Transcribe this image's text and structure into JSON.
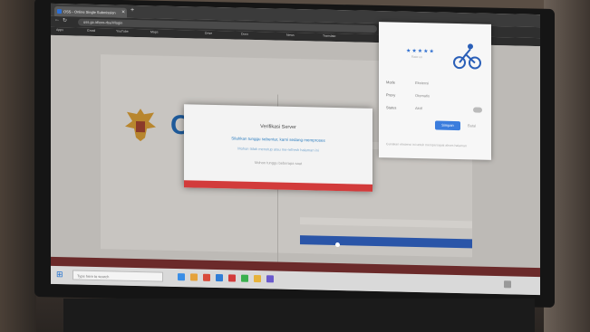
{
  "browser": {
    "tab_title": "OSS - Online Single Submission",
    "new_tab_icon": "plus-icon",
    "url": "oss.go.id/oss-rba/#/login",
    "bookmarks": [
      "Apps",
      "Gmail",
      "YouTube",
      "Maps",
      "Drive",
      "Docs",
      "News",
      "Translate"
    ]
  },
  "page": {
    "logo_text": "OSS",
    "emblem": "garuda-emblem"
  },
  "modal": {
    "title": "Verifikasi Server",
    "message": "Silahkan tunggu sebentar, kami sedang memproses",
    "sub_message": "Mohon tidak menutup atau me-refresh halaman ini",
    "note": "Mohon tunggu beberapa saat",
    "bar_color": "#d23b3b"
  },
  "popup": {
    "stars": "★★★★★",
    "rating_label": "Rate us",
    "rows": [
      {
        "label": "Mode",
        "value": "Ekstensi"
      },
      {
        "label": "Proxy",
        "value": "Otomatis"
      },
      {
        "label": "Status",
        "value": "Aktif"
      }
    ],
    "button": "Simpan",
    "link": "Batal",
    "footer": "Gunakan ekstensi ini untuk mempercepat akses halaman"
  },
  "taskbar": {
    "search_placeholder": "Type here to search"
  }
}
